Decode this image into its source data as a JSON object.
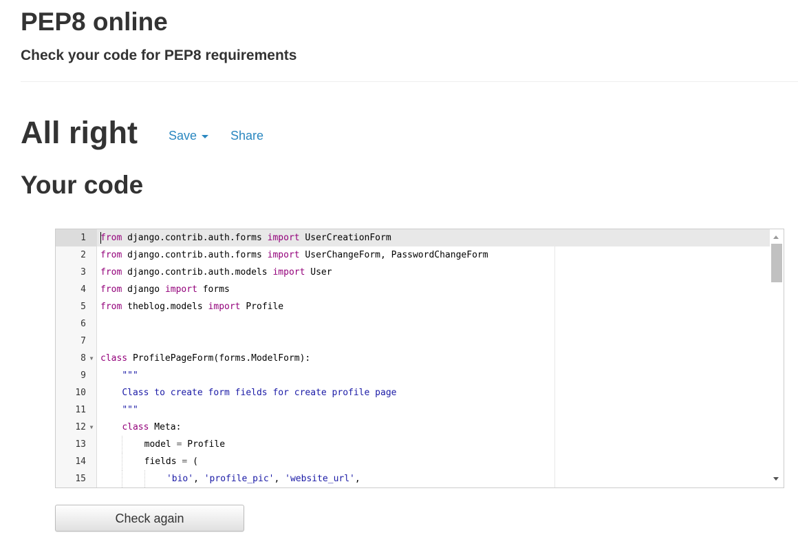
{
  "header": {
    "title": "PEP8 online",
    "subtitle": "Check your code for PEP8 requirements"
  },
  "result": {
    "title": "All right",
    "save_label": "Save",
    "share_label": "Share"
  },
  "code_section": {
    "title": "Your code"
  },
  "editor": {
    "active_line": 1,
    "lines": [
      {
        "num": "1",
        "fold": false,
        "text": "from django.contrib.auth.forms import UserCreationForm"
      },
      {
        "num": "2",
        "fold": false,
        "text": "from django.contrib.auth.forms import UserChangeForm, PasswordChangeForm"
      },
      {
        "num": "3",
        "fold": false,
        "text": "from django.contrib.auth.models import User"
      },
      {
        "num": "4",
        "fold": false,
        "text": "from django import forms"
      },
      {
        "num": "5",
        "fold": false,
        "text": "from theblog.models import Profile"
      },
      {
        "num": "6",
        "fold": false,
        "text": ""
      },
      {
        "num": "7",
        "fold": false,
        "text": ""
      },
      {
        "num": "8",
        "fold": true,
        "text": "class ProfilePageForm(forms.ModelForm):"
      },
      {
        "num": "9",
        "fold": false,
        "text": "    \"\"\""
      },
      {
        "num": "10",
        "fold": false,
        "text": "    Class to create form fields for create profile page"
      },
      {
        "num": "11",
        "fold": false,
        "text": "    \"\"\""
      },
      {
        "num": "12",
        "fold": true,
        "text": "    class Meta:"
      },
      {
        "num": "13",
        "fold": false,
        "text": "        model = Profile"
      },
      {
        "num": "14",
        "fold": false,
        "text": "        fields = ("
      },
      {
        "num": "15",
        "fold": false,
        "text": "            'bio', 'profile_pic', 'website_url',"
      }
    ]
  },
  "actions": {
    "check_again_label": "Check again"
  },
  "colors": {
    "link": "#2a87c0",
    "keyword": "#93007a",
    "string": "#1a1aa6"
  }
}
